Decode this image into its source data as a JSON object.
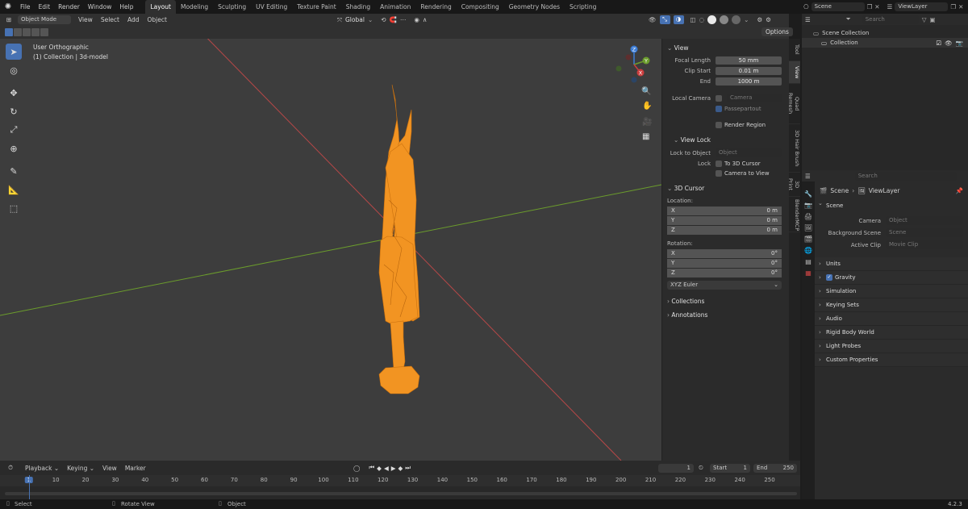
{
  "topbar": {
    "menus": [
      "File",
      "Edit",
      "Render",
      "Window",
      "Help"
    ],
    "workspaces": [
      "Layout",
      "Modeling",
      "Sculpting",
      "UV Editing",
      "Texture Paint",
      "Shading",
      "Animation",
      "Rendering",
      "Compositing",
      "Geometry Nodes",
      "Scripting"
    ],
    "active_workspace": "Layout",
    "scene": "Scene",
    "view_layer": "ViewLayer"
  },
  "viewport_header": {
    "mode": "Object Mode",
    "menus": [
      "View",
      "Select",
      "Add",
      "Object"
    ],
    "transform_orientation": "Global",
    "options_label": "Options"
  },
  "viewport": {
    "view_name": "User Orthographic",
    "collection_info": "(1) Collection | 3d-model",
    "gizmo": {
      "x": "X",
      "y": "Y",
      "z": "Z"
    }
  },
  "npanel": {
    "tabs": [
      "Tool",
      "View",
      "Quad Remesh",
      "3D Hair Brush",
      "3D Print",
      "BlenderMCP"
    ],
    "view": {
      "title": "View",
      "focal_length_label": "Focal Length",
      "focal_length": "50 mm",
      "clip_start_label": "Clip Start",
      "clip_start": "0.01 m",
      "end_label": "End",
      "end": "1000 m",
      "local_camera_label": "Local Camera",
      "local_camera_placeholder": "Camera",
      "passepartout_label": "Passepartout",
      "render_region_label": "Render Region"
    },
    "view_lock": {
      "title": "View Lock",
      "lock_to_object_label": "Lock to Object",
      "lock_to_object_placeholder": "Object",
      "lock_label": "Lock",
      "to_3d_cursor": "To 3D Cursor",
      "camera_to_view": "Camera to View"
    },
    "cursor": {
      "title": "3D Cursor",
      "location_label": "Location:",
      "location": [
        {
          "axis": "X",
          "value": "0 m"
        },
        {
          "axis": "Y",
          "value": "0 m"
        },
        {
          "axis": "Z",
          "value": "0 m"
        }
      ],
      "rotation_label": "Rotation:",
      "rotation": [
        {
          "axis": "X",
          "value": "0°"
        },
        {
          "axis": "Y",
          "value": "0°"
        },
        {
          "axis": "Z",
          "value": "0°"
        }
      ],
      "rotation_mode": "XYZ Euler"
    },
    "collections_label": "Collections",
    "annotations_label": "Annotations"
  },
  "outliner": {
    "search_placeholder": "Search",
    "root": "Scene Collection",
    "items": [
      "Collection"
    ]
  },
  "properties": {
    "search_placeholder": "Search",
    "breadcrumb_scene": "Scene",
    "breadcrumb_layer": "ViewLayer",
    "scene_panel": "Scene",
    "camera_label": "Camera",
    "camera_placeholder": "Object",
    "background_scene_label": "Background Scene",
    "background_scene_placeholder": "Scene",
    "active_clip_label": "Active Clip",
    "active_clip_placeholder": "Movie Clip",
    "sections": [
      "Units",
      "Gravity",
      "Simulation",
      "Keying Sets",
      "Audio",
      "Rigid Body World",
      "Light Probes",
      "Custom Properties"
    ],
    "gravity_checked": true
  },
  "timeline": {
    "menus": [
      "Playback",
      "Keying",
      "View",
      "Marker"
    ],
    "current_frame": "1",
    "start_label": "Start",
    "start": "1",
    "end_label": "End",
    "end": "250",
    "ruler": [
      "1",
      "10",
      "20",
      "30",
      "40",
      "50",
      "60",
      "70",
      "80",
      "90",
      "100",
      "110",
      "120",
      "130",
      "140",
      "150",
      "160",
      "170",
      "180",
      "190",
      "200",
      "210",
      "220",
      "230",
      "240",
      "250"
    ]
  },
  "statusbar": {
    "select": "Select",
    "rotate_view": "Rotate View",
    "object": "Object",
    "version": "4.2.3"
  },
  "colors": {
    "accent": "#4772b3",
    "object_orange": "#f29422",
    "x_axis": "#cc3e3e",
    "y_axis": "#6b9c2c",
    "z_axis": "#3d7dd6"
  }
}
